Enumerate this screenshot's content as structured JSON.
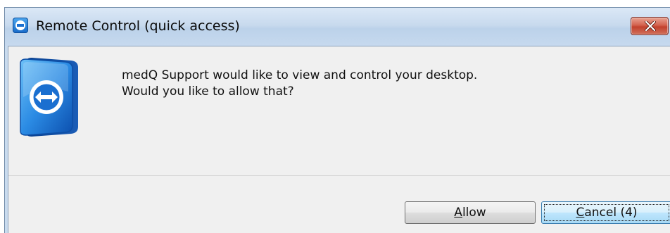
{
  "window": {
    "title": "Remote Control (quick access)",
    "app_icon": "teamviewer-icon",
    "close_icon": "close-icon"
  },
  "message": {
    "line1": "medQ Support would like to view and control your desktop.",
    "line2": "Would you like to allow that?"
  },
  "buttons": {
    "allow_access_key": "A",
    "allow_rest": "llow",
    "cancel_access_key": "C",
    "cancel_rest": "ancel (4)"
  },
  "colors": {
    "titlebar": "#c8daee",
    "close_button": "#c2412d",
    "content_background": "#f0f0f0",
    "icon_blue": "#1a6fd0",
    "default_button": "#bee6fd"
  }
}
